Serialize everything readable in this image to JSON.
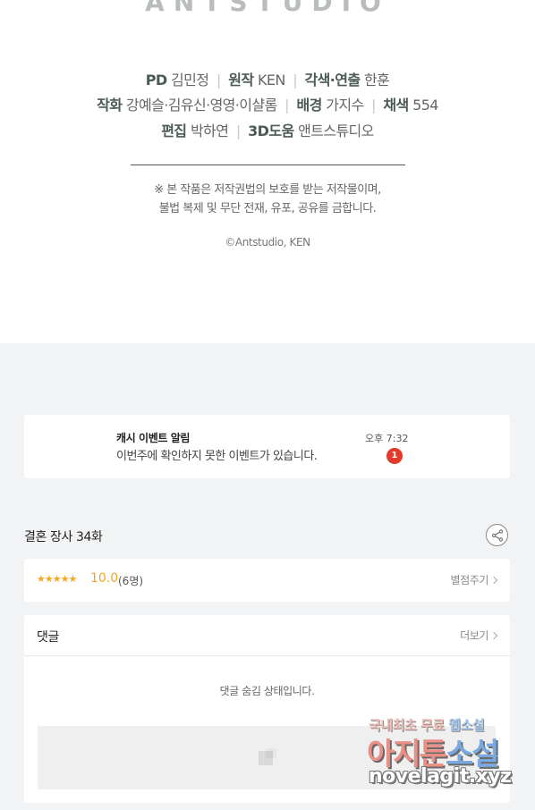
{
  "credits": {
    "logo_text": "ANTSTUDIO",
    "line1": [
      {
        "role": "PD",
        "name": "김민정"
      },
      {
        "role": "원작",
        "name": "KEN"
      },
      {
        "role": "각색·연출",
        "name": "한훈"
      }
    ],
    "line2": [
      {
        "role": "작화",
        "name": "강예슬·김유신·영영·이샬롬"
      },
      {
        "role": "배경",
        "name": "가지수"
      },
      {
        "role": "채색",
        "name": "554"
      }
    ],
    "line3": [
      {
        "role": "편집",
        "name": "박하연"
      },
      {
        "role": "3D도움",
        "name": "앤트스튜디오"
      }
    ],
    "separator": "|",
    "notice_line1": "※ 본 작품은 저작권법의 보호를 받는 저작물이며,",
    "notice_line2": "불법 복제 및 무단 전재, 유포, 공유를 금합니다.",
    "copyright": "©Antstudio, KEN"
  },
  "event": {
    "title": "캐시 이벤트 알림",
    "message": "이번주에 확인하지 못한 이벤트가 있습니다.",
    "time": "오후 7:32",
    "badge_count": "1"
  },
  "episode": {
    "title": "결혼 장사 34화",
    "share_icon": "share-icon"
  },
  "rating": {
    "stars": "★★★★★",
    "value": "10.0",
    "count": "(6명)",
    "rate_label": "별점주기"
  },
  "comments": {
    "header": "댓글",
    "more_label": "더보기",
    "hidden_message": "댓글 숨김 상태입니다."
  },
  "watermark": {
    "top_text": "국내최초 무료",
    "top_highlight": "웹소설",
    "main_text": "아지툰",
    "main_highlight": "소설",
    "url": "novelagit.xyz"
  },
  "colors": {
    "accent_star": "#f5a623",
    "badge": "#e23b2a",
    "grey_bg": "#f2f3f5"
  }
}
